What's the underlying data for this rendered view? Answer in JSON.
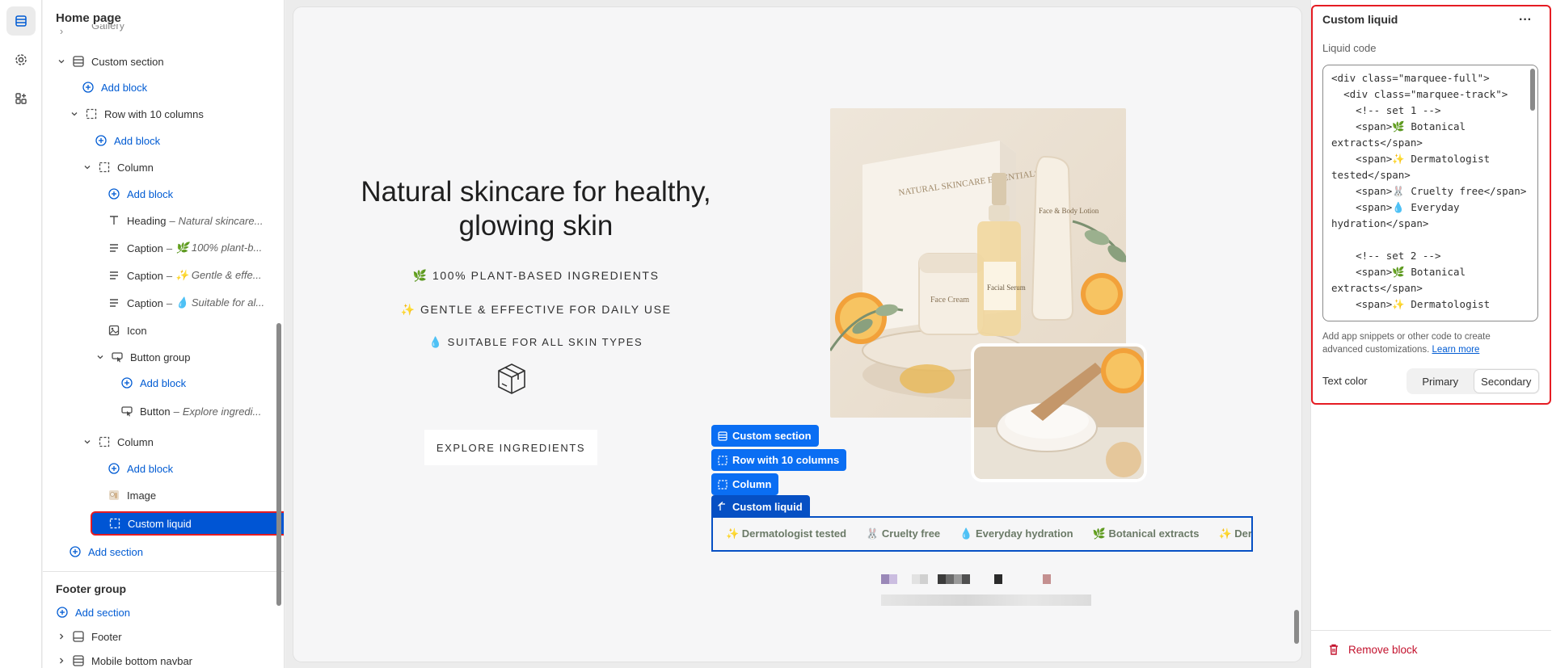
{
  "sidebar": {
    "title": "Home page",
    "partial_top_label": "Gallery",
    "items": [
      {
        "label": "Custom section",
        "kind": "section"
      },
      {
        "label": "Add block",
        "kind": "add"
      },
      {
        "label": "Row with 10 columns",
        "kind": "group"
      },
      {
        "label": "Add block",
        "kind": "add"
      },
      {
        "label": "Column",
        "kind": "group"
      },
      {
        "label": "Add block",
        "kind": "add"
      },
      {
        "label": "Heading",
        "sub": "Natural skincare...",
        "kind": "text"
      },
      {
        "label": "Caption",
        "sub": "🌿 100% plant-b...",
        "kind": "lines"
      },
      {
        "label": "Caption",
        "sub": "✨ Gentle & effe...",
        "kind": "lines"
      },
      {
        "label": "Caption",
        "sub": "💧 Suitable for al...",
        "kind": "lines"
      },
      {
        "label": "Icon",
        "kind": "image"
      },
      {
        "label": "Button group",
        "kind": "cursor"
      },
      {
        "label": "Add block",
        "kind": "add"
      },
      {
        "label": "Button",
        "sub": "Explore ingredi...",
        "kind": "cursor"
      },
      {
        "label": "Column",
        "kind": "group"
      },
      {
        "label": "Add block",
        "kind": "add"
      },
      {
        "label": "Image",
        "kind": "photo"
      },
      {
        "label": "Custom liquid",
        "kind": "group"
      },
      {
        "label": "Add section",
        "kind": "add"
      }
    ],
    "footer_group": {
      "title": "Footer group",
      "add_label": "Add section",
      "items": [
        "Footer",
        "Mobile bottom navbar"
      ]
    }
  },
  "preview": {
    "heading": "Natural skincare for healthy, glowing skin",
    "captions": [
      "🌿 100% PLANT-BASED INGREDIENTS",
      "✨ GENTLE & EFFECTIVE FOR DAILY USE",
      "💧 SUITABLE FOR ALL SKIN TYPES"
    ],
    "button_label": "EXPLORE INGREDIENTS",
    "product_box_text": "NATURAL SKINCARE ESSENTIALS",
    "bottle_label": "Facial Serum",
    "tube_label": "Face & Body Lotion",
    "jar_label": "Face Cream",
    "tags": [
      "Custom section",
      "Row with 10 columns",
      "Column",
      "Custom liquid"
    ],
    "marquee_items": [
      "✨ Dermatologist tested",
      "🐰 Cruelty free",
      "💧 Everyday hydration",
      "🌿 Botanical extracts",
      "✨ Derma"
    ]
  },
  "panel": {
    "title": "Custom liquid",
    "more_label": "···",
    "code_label": "Liquid code",
    "code": "<div class=\"marquee-full\">\n  <div class=\"marquee-track\">\n    <!-- set 1 -->\n    <span>🌿 Botanical extracts</span>\n    <span>✨ Dermatologist tested</span>\n    <span>🐰 Cruelty free</span>\n    <span>💧 Everyday hydration</span>\n\n    <!-- set 2 -->\n    <span>🌿 Botanical extracts</span>\n    <span>✨ Dermatologist",
    "help_text": "Add app snippets or other code to create advanced customizations.",
    "help_link": "Learn more",
    "text_color_label": "Text color",
    "text_color_options": [
      "Primary",
      "Secondary"
    ],
    "text_color_selected": "Secondary",
    "remove_label": "Remove block"
  },
  "colors": {
    "accent_blue": "#005bd3",
    "selection_blue": "#0055d4",
    "highlight_red": "#e51c23",
    "danger": "#c3122d"
  }
}
